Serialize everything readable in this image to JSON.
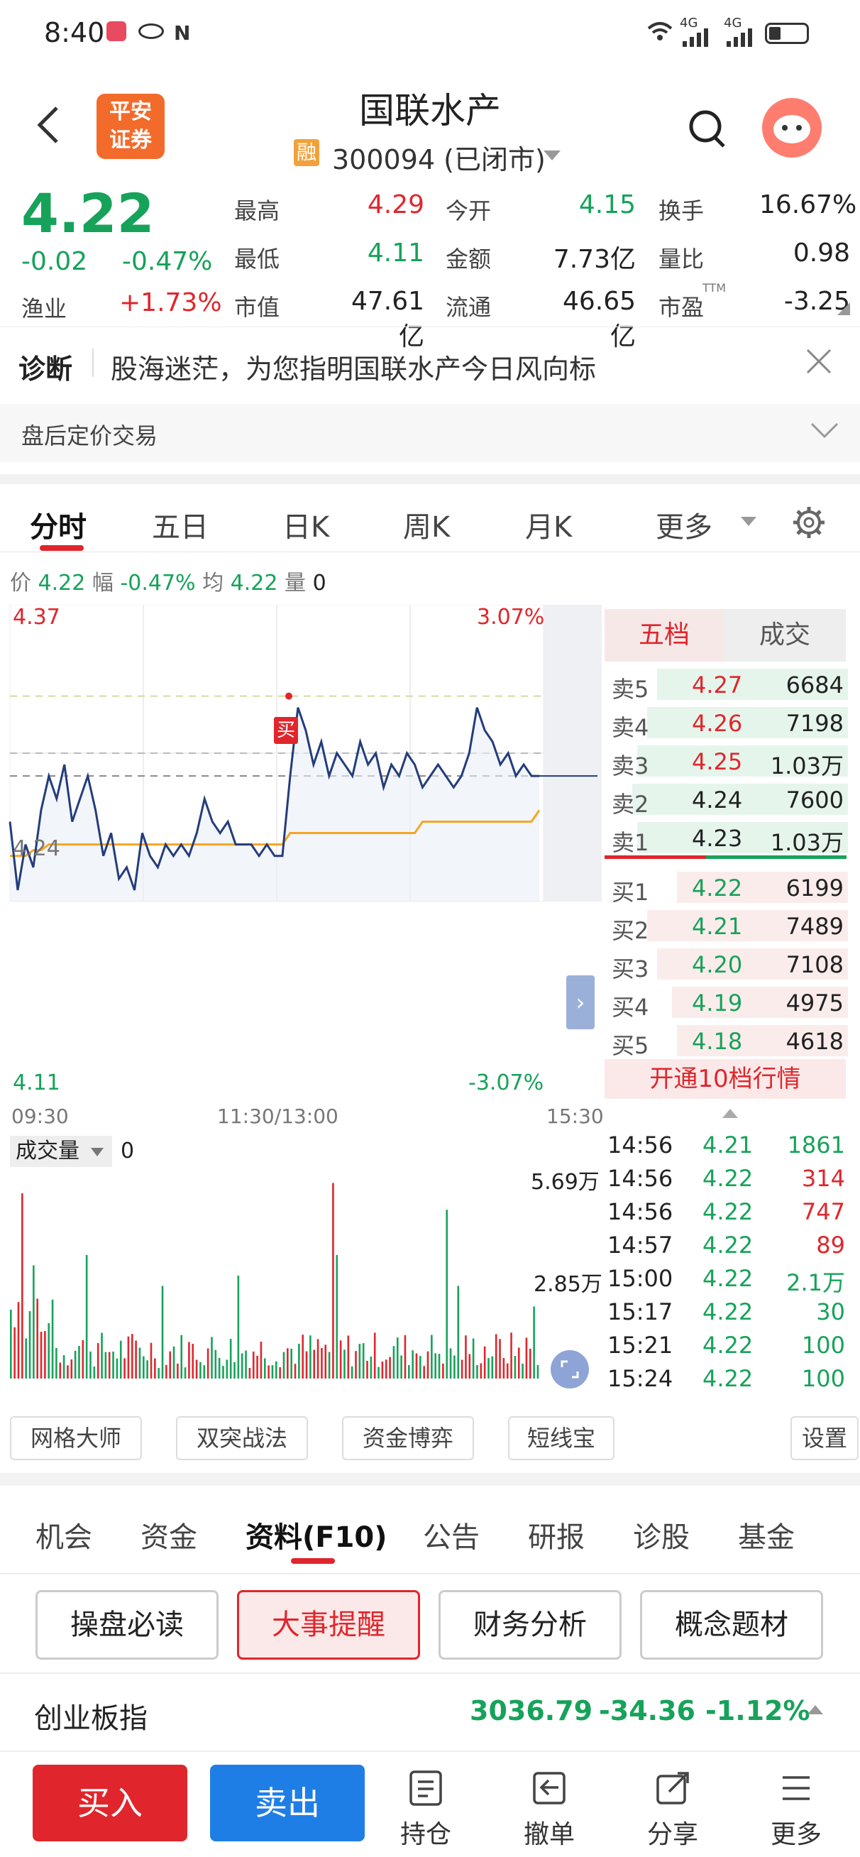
{
  "status_bar": {
    "time": "8:40",
    "network": "4G"
  },
  "header": {
    "back_icon": "chevron-left-icon",
    "broker_logo_line1": "平安",
    "broker_logo_line2": "证券",
    "stock_name": "国联水产",
    "margin_badge": "融",
    "code_status": "300094 (已闭市)",
    "search_icon": "search-icon",
    "avatar_icon": "mascot-avatar"
  },
  "quote": {
    "price": "4.22",
    "change": "-0.02",
    "change_pct": "-0.47%",
    "sector": "渔业",
    "sector_pct": "+1.73%",
    "fields": [
      {
        "label": "最高",
        "value": "4.29",
        "color": "red"
      },
      {
        "label": "今开",
        "value": "4.15",
        "color": "green"
      },
      {
        "label": "换手",
        "value": "16.67%",
        "color": "black"
      },
      {
        "label": "最低",
        "value": "4.11",
        "color": "green"
      },
      {
        "label": "金额",
        "value": "7.73亿",
        "color": "black"
      },
      {
        "label": "量比",
        "value": "0.98",
        "color": "black"
      },
      {
        "label": "市值",
        "value": "47.61亿",
        "color": "black"
      },
      {
        "label": "流通",
        "value": "46.65亿",
        "color": "black"
      },
      {
        "label": "市盈",
        "value": "-3.25",
        "color": "black"
      }
    ],
    "pe_sup": "TTM"
  },
  "diagnosis": {
    "label": "诊断",
    "text": "股海迷茫，为您指明国联水产今日风向标",
    "after_hours": "盘后定价交易"
  },
  "chart_tabs": [
    "分时",
    "五日",
    "日K",
    "周K",
    "月K",
    "更多"
  ],
  "info_bar": {
    "price_label": "价",
    "price": "4.22",
    "amp_label": "幅",
    "amp": "-0.47%",
    "avg_label": "均",
    "avg": "4.22",
    "vol_label": "量",
    "vol": "0"
  },
  "intraday": {
    "y_max": "4.37",
    "y_mid": "4.24",
    "y_min": "4.11",
    "pct_max": "3.07%",
    "pct_min": "-3.07%",
    "t_start": "09:30",
    "t_mid": "11:30/13:00",
    "t_end": "15:30",
    "buy_marker": "买"
  },
  "chart_data": {
    "type": "line",
    "title": "",
    "x_range": [
      "09:30",
      "15:00"
    ],
    "ylim": [
      4.11,
      4.37
    ],
    "series": [
      {
        "values": [
          4.18,
          4.12,
          4.16,
          4.14,
          4.19,
          4.22,
          4.2,
          4.23,
          4.18,
          4.2,
          4.22,
          4.19,
          4.15,
          4.17,
          4.13,
          4.14,
          4.12,
          4.17,
          4.15,
          4.14,
          4.16,
          4.15,
          4.16,
          4.15,
          4.17,
          4.2,
          4.18,
          4.17,
          4.18,
          4.16,
          4.16,
          4.16,
          4.15,
          4.16,
          4.15,
          4.15,
          4.22,
          4.28,
          4.26,
          4.23,
          4.25,
          4.22,
          4.24,
          4.23,
          4.22,
          4.25,
          4.23,
          4.24,
          4.21,
          4.23,
          4.22,
          4.24,
          4.23,
          4.21,
          4.22,
          4.23,
          4.22,
          4.21,
          4.22,
          4.24,
          4.28,
          4.26,
          4.25,
          4.23,
          4.24,
          4.22,
          4.23,
          4.22,
          4.22
        ]
      },
      {
        "values": [
          4.15,
          4.15,
          4.15,
          4.155,
          4.155,
          4.16,
          4.16,
          4.16,
          4.16,
          4.16,
          4.16,
          4.16,
          4.16,
          4.16,
          4.16,
          4.16,
          4.16,
          4.16,
          4.16,
          4.16,
          4.16,
          4.16,
          4.16,
          4.16,
          4.16,
          4.16,
          4.16,
          4.16,
          4.16,
          4.16,
          4.16,
          4.16,
          4.16,
          4.16,
          4.16,
          4.16,
          4.17,
          4.17,
          4.17,
          4.17,
          4.17,
          4.17,
          4.17,
          4.17,
          4.17,
          4.17,
          4.17,
          4.17,
          4.17,
          4.17,
          4.17,
          4.17,
          4.17,
          4.18,
          4.18,
          4.18,
          4.18,
          4.18,
          4.18,
          4.18,
          4.18,
          4.18,
          4.18,
          4.18,
          4.18,
          4.18,
          4.18,
          4.18,
          4.19
        ]
      }
    ],
    "colors": {
      "price": "#233d7b",
      "avg": "#f5a623",
      "up": "#e0262c",
      "down": "#17a25a"
    }
  },
  "order_book": {
    "tab_active": "五档",
    "tab_other": "成交",
    "asks": [
      {
        "label": "卖5",
        "price": "4.27",
        "vol": "6684",
        "color": "red"
      },
      {
        "label": "卖4",
        "price": "4.26",
        "vol": "7198",
        "color": "red"
      },
      {
        "label": "卖3",
        "price": "4.25",
        "vol": "1.03万",
        "color": "red"
      },
      {
        "label": "卖2",
        "price": "4.24",
        "vol": "7600",
        "color": "black"
      },
      {
        "label": "卖1",
        "price": "4.23",
        "vol": "1.03万",
        "color": "black"
      }
    ],
    "bids": [
      {
        "label": "买1",
        "price": "4.22",
        "vol": "6199",
        "color": "green"
      },
      {
        "label": "买2",
        "price": "4.21",
        "vol": "7489",
        "color": "green"
      },
      {
        "label": "买3",
        "price": "4.20",
        "vol": "7108",
        "color": "green"
      },
      {
        "label": "买4",
        "price": "4.19",
        "vol": "4975",
        "color": "green"
      },
      {
        "label": "买5",
        "price": "4.18",
        "vol": "4618",
        "color": "green"
      }
    ],
    "upgrade": "开通10档行情"
  },
  "volume": {
    "label": "成交量",
    "value": "0",
    "max": "5.69万",
    "mid": "2.85万"
  },
  "ticks": [
    {
      "time": "14:56",
      "price": "4.21",
      "vol": "1861",
      "vcolor": "green"
    },
    {
      "time": "14:56",
      "price": "4.22",
      "vol": "314",
      "vcolor": "red"
    },
    {
      "time": "14:56",
      "price": "4.22",
      "vol": "747",
      "vcolor": "red"
    },
    {
      "time": "14:57",
      "price": "4.22",
      "vol": "89",
      "vcolor": "red"
    },
    {
      "time": "15:00",
      "price": "4.22",
      "vol": "2.1万",
      "vcolor": "green"
    },
    {
      "time": "15:17",
      "price": "4.22",
      "vol": "30",
      "vcolor": "green"
    },
    {
      "time": "15:21",
      "price": "4.22",
      "vol": "100",
      "vcolor": "green"
    },
    {
      "time": "15:24",
      "price": "4.22",
      "vol": "100",
      "vcolor": "green"
    }
  ],
  "tools": [
    "网格大师",
    "双突战法",
    "资金博弈",
    "短线宝",
    "设置"
  ],
  "f10_tabs": [
    "机会",
    "资金",
    "资料(F10)",
    "公告",
    "研报",
    "诊股",
    "基金"
  ],
  "f10_sub": [
    "操盘必读",
    "大事提醒",
    "财务分析",
    "概念题材"
  ],
  "index": {
    "name": "创业板指",
    "value": "3036.79",
    "change": "-34.36",
    "pct": "-1.12%"
  },
  "bottom_nav": {
    "buy": "买入",
    "sell": "卖出",
    "items": [
      "持仓",
      "撤单",
      "分享",
      "更多"
    ]
  }
}
